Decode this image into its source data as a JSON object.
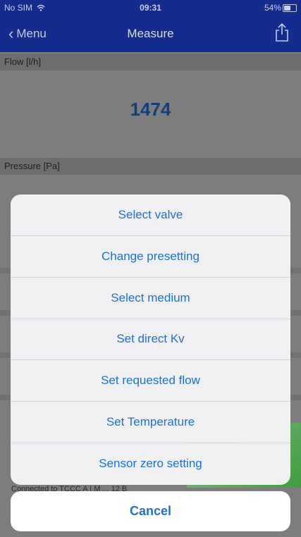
{
  "status_bar": {
    "carrier": "No SIM",
    "time": "09:31",
    "battery": "54%",
    "battery_level": 0.54
  },
  "nav": {
    "back_label": "Menu",
    "title": "Measure"
  },
  "sections": {
    "flow_label": "Flow [l/h]",
    "flow_value": "1474",
    "pressure_label": "Pressure [Pa]"
  },
  "footer": {
    "connected_text": "Connected to TCCC A I M ... 12 B"
  },
  "action_sheet": {
    "items": [
      "Select valve",
      "Change presetting",
      "Select medium",
      "Set direct Kv",
      "Set requested flow",
      "Set Temperature",
      "Sensor zero setting"
    ],
    "cancel_label": "Cancel"
  },
  "colors": {
    "nav_bg": "#152c8f",
    "accent": "#1a73d9",
    "flow_value": "#0f3f7d"
  }
}
